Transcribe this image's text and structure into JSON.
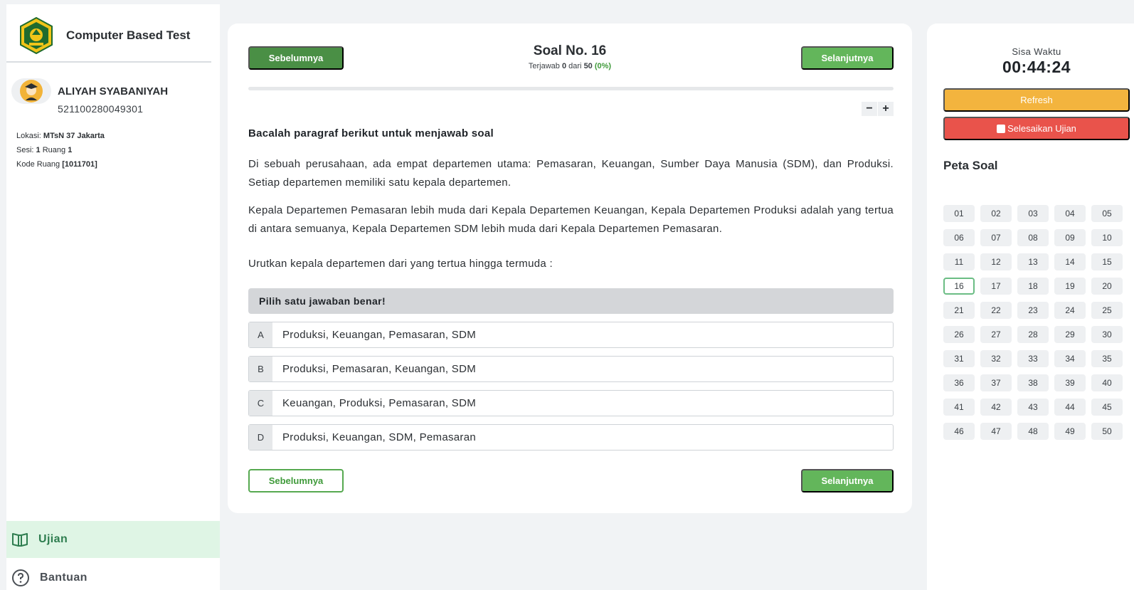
{
  "app": {
    "title": "Computer Based Test"
  },
  "user": {
    "name": "ALIYAH SYABANIYAH",
    "id": "521100280049301",
    "lokasi_label": "Lokasi:",
    "lokasi_value": "MTsN 37 Jakarta",
    "sesi_label": "Sesi:",
    "sesi_value": "1",
    "ruang_label": "Ruang",
    "ruang_value": "1",
    "kode_label": "Kode Ruang",
    "kode_value": "[1011701]"
  },
  "nav": {
    "items": [
      {
        "label": "Ujian",
        "icon": "book-icon",
        "active": true
      },
      {
        "label": "Bantuan",
        "icon": "help-circle-icon",
        "active": false
      }
    ]
  },
  "exam": {
    "prev_label": "Sebelumnya",
    "next_label": "Selanjutnya",
    "title": "Soal No. 16",
    "answered_prefix": "Terjawab",
    "answered_count": "0",
    "answered_mid": "dari",
    "total": "50",
    "answered_pct": "(0%)",
    "progress_fraction": 0.0,
    "zoom_out": "−",
    "zoom_in": "+"
  },
  "question": {
    "heading": "Bacalah paragraf berikut untuk menjawab soal",
    "paragraph1": "Di sebuah perusahaan, ada empat departemen utama: Pemasaran, Keuangan, Sumber Daya Manusia (SDM), dan Produksi. Setiap departemen memiliki satu kepala departemen.",
    "paragraph2": "Kepala Departemen Pemasaran lebih muda dari Kepala Departemen Keuangan, Kepala Departemen Produksi adalah yang tertua di antara semuanya, Kepala Departemen SDM lebih muda dari Kepala Departemen Pemasaran.",
    "prompt": "Urutkan kepala departemen dari yang tertua hingga termuda :",
    "answer_header": "Pilih satu jawaban benar!",
    "options": [
      {
        "letter": "A",
        "text": "Produksi, Keuangan, Pemasaran, SDM"
      },
      {
        "letter": "B",
        "text": "Produksi, Pemasaran, Keuangan, SDM"
      },
      {
        "letter": "C",
        "text": "Keuangan, Produksi, Pemasaran, SDM"
      },
      {
        "letter": "D",
        "text": "Produksi, Keuangan, SDM, Pemasaran"
      }
    ]
  },
  "timer": {
    "label": "Sisa Waktu",
    "value": "00:44:24",
    "refresh_label": "Refresh",
    "finish_label": "Selesaikan Ujian"
  },
  "map": {
    "title": "Peta Soal",
    "current": "16",
    "numbers": [
      "01",
      "02",
      "03",
      "04",
      "05",
      "06",
      "07",
      "08",
      "09",
      "10",
      "11",
      "12",
      "13",
      "14",
      "15",
      "16",
      "17",
      "18",
      "19",
      "20",
      "21",
      "22",
      "23",
      "24",
      "25",
      "26",
      "27",
      "28",
      "29",
      "30",
      "31",
      "32",
      "33",
      "34",
      "35",
      "36",
      "37",
      "38",
      "39",
      "40",
      "41",
      "42",
      "43",
      "44",
      "45",
      "46",
      "47",
      "48",
      "49",
      "50"
    ]
  },
  "colors": {
    "primary_green": "#63b65b",
    "dark_green": "#4a8f45",
    "warning": "#f3b43e",
    "danger": "#e9534b",
    "nav_active_bg": "#dff5e5"
  }
}
